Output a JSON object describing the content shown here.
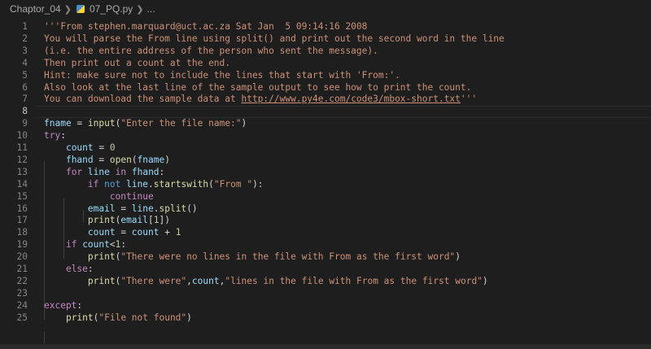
{
  "breadcrumb": {
    "folder": "Chaptor_04",
    "file": "07_PQ.py",
    "more": "..."
  },
  "editor": {
    "lines": [
      {
        "n": "1",
        "tokens": [
          {
            "t": "'''From stephen.marquard@uct.ac.za Sat Jan  5 09:14:16 2008",
            "c": "str"
          }
        ]
      },
      {
        "n": "2",
        "tokens": [
          {
            "t": "You will parse the From line using split() and print out the second word in the line",
            "c": "str"
          }
        ]
      },
      {
        "n": "3",
        "tokens": [
          {
            "t": "(i.e. the entire address of the person who sent the message).",
            "c": "str"
          }
        ]
      },
      {
        "n": "4",
        "tokens": [
          {
            "t": "Then print out a count at the end.",
            "c": "str"
          }
        ]
      },
      {
        "n": "5",
        "tokens": [
          {
            "t": "Hint: make sure not to include the lines that start with 'From:'.",
            "c": "str"
          }
        ]
      },
      {
        "n": "6",
        "tokens": [
          {
            "t": "Also look at the last line of the sample output to see how to print the count.",
            "c": "str"
          }
        ]
      },
      {
        "n": "7",
        "tokens": [
          {
            "t": "You can download the sample data at ",
            "c": "str"
          },
          {
            "t": "http://www.py4e.com/code3/mbox-short.txt",
            "c": "str url"
          },
          {
            "t": "'''",
            "c": "str"
          }
        ]
      },
      {
        "n": "8",
        "current": true,
        "tokens": []
      },
      {
        "n": "9",
        "tokens": [
          {
            "t": "fname",
            "c": "var"
          },
          {
            "t": " = ",
            "c": "op"
          },
          {
            "t": "input",
            "c": "fn"
          },
          {
            "t": "(",
            "c": "op"
          },
          {
            "t": "\"Enter the file name:\"",
            "c": "str"
          },
          {
            "t": ")",
            "c": "op"
          }
        ]
      },
      {
        "n": "10",
        "tokens": [
          {
            "t": "try",
            "c": "kw"
          },
          {
            "t": ":",
            "c": "op"
          }
        ]
      },
      {
        "n": "11",
        "tokens": [
          {
            "t": "    "
          },
          {
            "t": "count",
            "c": "var"
          },
          {
            "t": " = ",
            "c": "op"
          },
          {
            "t": "0",
            "c": "num"
          }
        ]
      },
      {
        "n": "12",
        "tokens": [
          {
            "t": "    "
          },
          {
            "t": "fhand",
            "c": "var"
          },
          {
            "t": " = ",
            "c": "op"
          },
          {
            "t": "open",
            "c": "fn"
          },
          {
            "t": "(",
            "c": "op"
          },
          {
            "t": "fname",
            "c": "var"
          },
          {
            "t": ")",
            "c": "op"
          }
        ]
      },
      {
        "n": "13",
        "tokens": [
          {
            "t": "    "
          },
          {
            "t": "for",
            "c": "kw"
          },
          {
            "t": " "
          },
          {
            "t": "line",
            "c": "var"
          },
          {
            "t": " "
          },
          {
            "t": "in",
            "c": "kw"
          },
          {
            "t": " "
          },
          {
            "t": "fhand",
            "c": "var"
          },
          {
            "t": ":",
            "c": "op"
          }
        ]
      },
      {
        "n": "14",
        "tokens": [
          {
            "t": "        "
          },
          {
            "t": "if",
            "c": "kw"
          },
          {
            "t": " "
          },
          {
            "t": "not",
            "c": "kwb"
          },
          {
            "t": " "
          },
          {
            "t": "line",
            "c": "var"
          },
          {
            "t": ".",
            "c": "op"
          },
          {
            "t": "startswith",
            "c": "fn"
          },
          {
            "t": "(",
            "c": "op"
          },
          {
            "t": "\"From \"",
            "c": "str"
          },
          {
            "t": "):",
            "c": "op"
          }
        ]
      },
      {
        "n": "15",
        "tokens": [
          {
            "t": "            "
          },
          {
            "t": "continue",
            "c": "kw"
          }
        ]
      },
      {
        "n": "16",
        "tokens": [
          {
            "t": "        "
          },
          {
            "t": "email",
            "c": "var"
          },
          {
            "t": " = ",
            "c": "op"
          },
          {
            "t": "line",
            "c": "var"
          },
          {
            "t": ".",
            "c": "op"
          },
          {
            "t": "split",
            "c": "fn"
          },
          {
            "t": "()",
            "c": "op"
          }
        ]
      },
      {
        "n": "17",
        "tokens": [
          {
            "t": "        "
          },
          {
            "t": "print",
            "c": "fn"
          },
          {
            "t": "(",
            "c": "op"
          },
          {
            "t": "email",
            "c": "var"
          },
          {
            "t": "[",
            "c": "op"
          },
          {
            "t": "1",
            "c": "num"
          },
          {
            "t": "])",
            "c": "op"
          }
        ]
      },
      {
        "n": "18",
        "tokens": [
          {
            "t": "        "
          },
          {
            "t": "count",
            "c": "var"
          },
          {
            "t": " = ",
            "c": "op"
          },
          {
            "t": "count",
            "c": "var"
          },
          {
            "t": " + ",
            "c": "op"
          },
          {
            "t": "1",
            "c": "num"
          }
        ]
      },
      {
        "n": "19",
        "tokens": [
          {
            "t": "    "
          },
          {
            "t": "if",
            "c": "kw"
          },
          {
            "t": " "
          },
          {
            "t": "count",
            "c": "var"
          },
          {
            "t": "<",
            "c": "op"
          },
          {
            "t": "1",
            "c": "num"
          },
          {
            "t": ":",
            "c": "op"
          }
        ]
      },
      {
        "n": "20",
        "tokens": [
          {
            "t": "        "
          },
          {
            "t": "print",
            "c": "fn"
          },
          {
            "t": "(",
            "c": "op"
          },
          {
            "t": "\"There were no lines in the file with From as the first word\"",
            "c": "str"
          },
          {
            "t": ")",
            "c": "op"
          }
        ]
      },
      {
        "n": "21",
        "tokens": [
          {
            "t": "    "
          },
          {
            "t": "else",
            "c": "kw"
          },
          {
            "t": ":",
            "c": "op"
          }
        ]
      },
      {
        "n": "22",
        "tokens": [
          {
            "t": "        "
          },
          {
            "t": "print",
            "c": "fn"
          },
          {
            "t": "(",
            "c": "op"
          },
          {
            "t": "\"There were\"",
            "c": "str"
          },
          {
            "t": ",",
            "c": "op"
          },
          {
            "t": "count",
            "c": "var"
          },
          {
            "t": ",",
            "c": "op"
          },
          {
            "t": "\"lines in the file with From as the first word\"",
            "c": "str"
          },
          {
            "t": ")",
            "c": "op"
          }
        ]
      },
      {
        "n": "23",
        "tokens": []
      },
      {
        "n": "24",
        "tokens": [
          {
            "t": "except",
            "c": "kw"
          },
          {
            "t": ":",
            "c": "op"
          }
        ]
      },
      {
        "n": "25",
        "tokens": [
          {
            "t": "    "
          },
          {
            "t": "print",
            "c": "fn"
          },
          {
            "t": "(",
            "c": "op"
          },
          {
            "t": "\"File not found\"",
            "c": "str"
          },
          {
            "t": ")",
            "c": "op"
          }
        ]
      }
    ]
  },
  "colors": {
    "background": "#1e1e1e",
    "string": "#ce9178",
    "keyword": "#c586c0",
    "function": "#dcdcaa",
    "variable": "#9cdcfe",
    "number": "#b5cea8"
  }
}
